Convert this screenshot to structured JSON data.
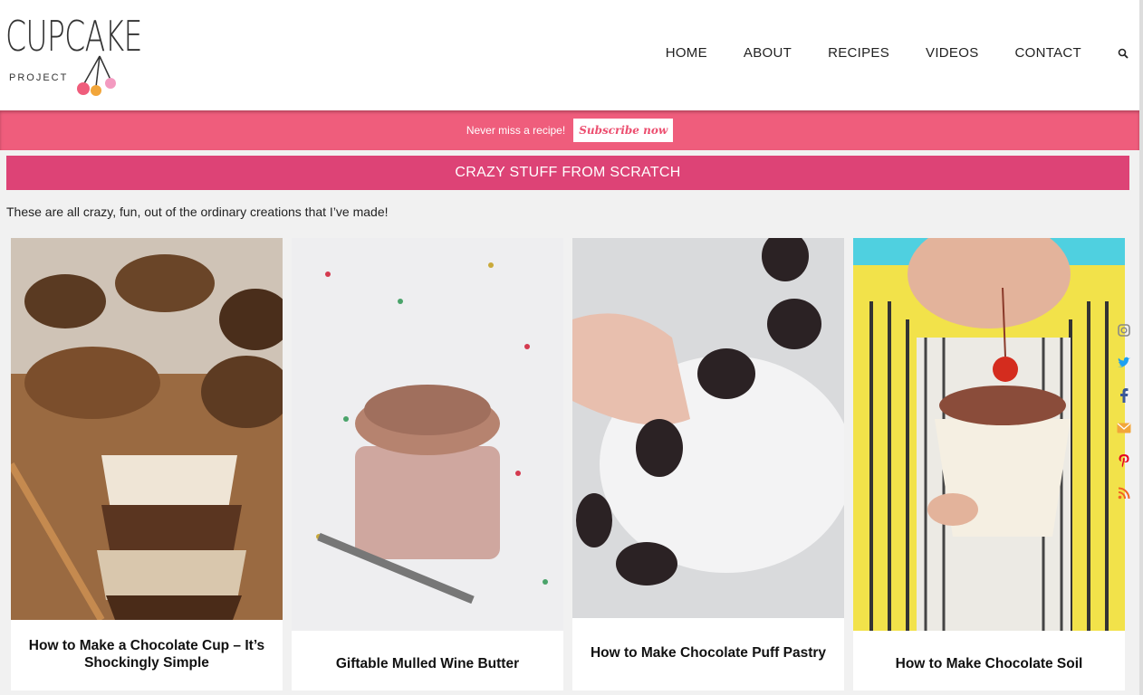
{
  "logo": {
    "text": "CUPCAKE",
    "sub": "PROJECT"
  },
  "nav": {
    "items": [
      "HOME",
      "ABOUT",
      "RECIPES",
      "VIDEOS",
      "CONTACT"
    ],
    "search_icon": "search-icon"
  },
  "banner": {
    "text": "Never miss a recipe!",
    "button": "Subscribe now"
  },
  "category": {
    "title": "CRAZY STUFF FROM SCRATCH",
    "intro": "These are all crazy, fun, out of the ordinary creations that I’ve made!"
  },
  "cards": [
    {
      "title": "How to Make a Chocolate Cup – It’s Shockingly Simple"
    },
    {
      "title": "Giftable Mulled Wine Butter"
    },
    {
      "title": "How to Make Chocolate Puff Pastry"
    },
    {
      "title": "How to Make Chocolate Soil"
    }
  ],
  "social": [
    "instagram-icon",
    "twitter-icon",
    "facebook-icon",
    "email-icon",
    "pinterest-icon",
    "rss-icon"
  ],
  "colors": {
    "banner": "#ef5d7c",
    "category_bar": "#dd4376",
    "subscribe_text": "#ec4e6f"
  }
}
